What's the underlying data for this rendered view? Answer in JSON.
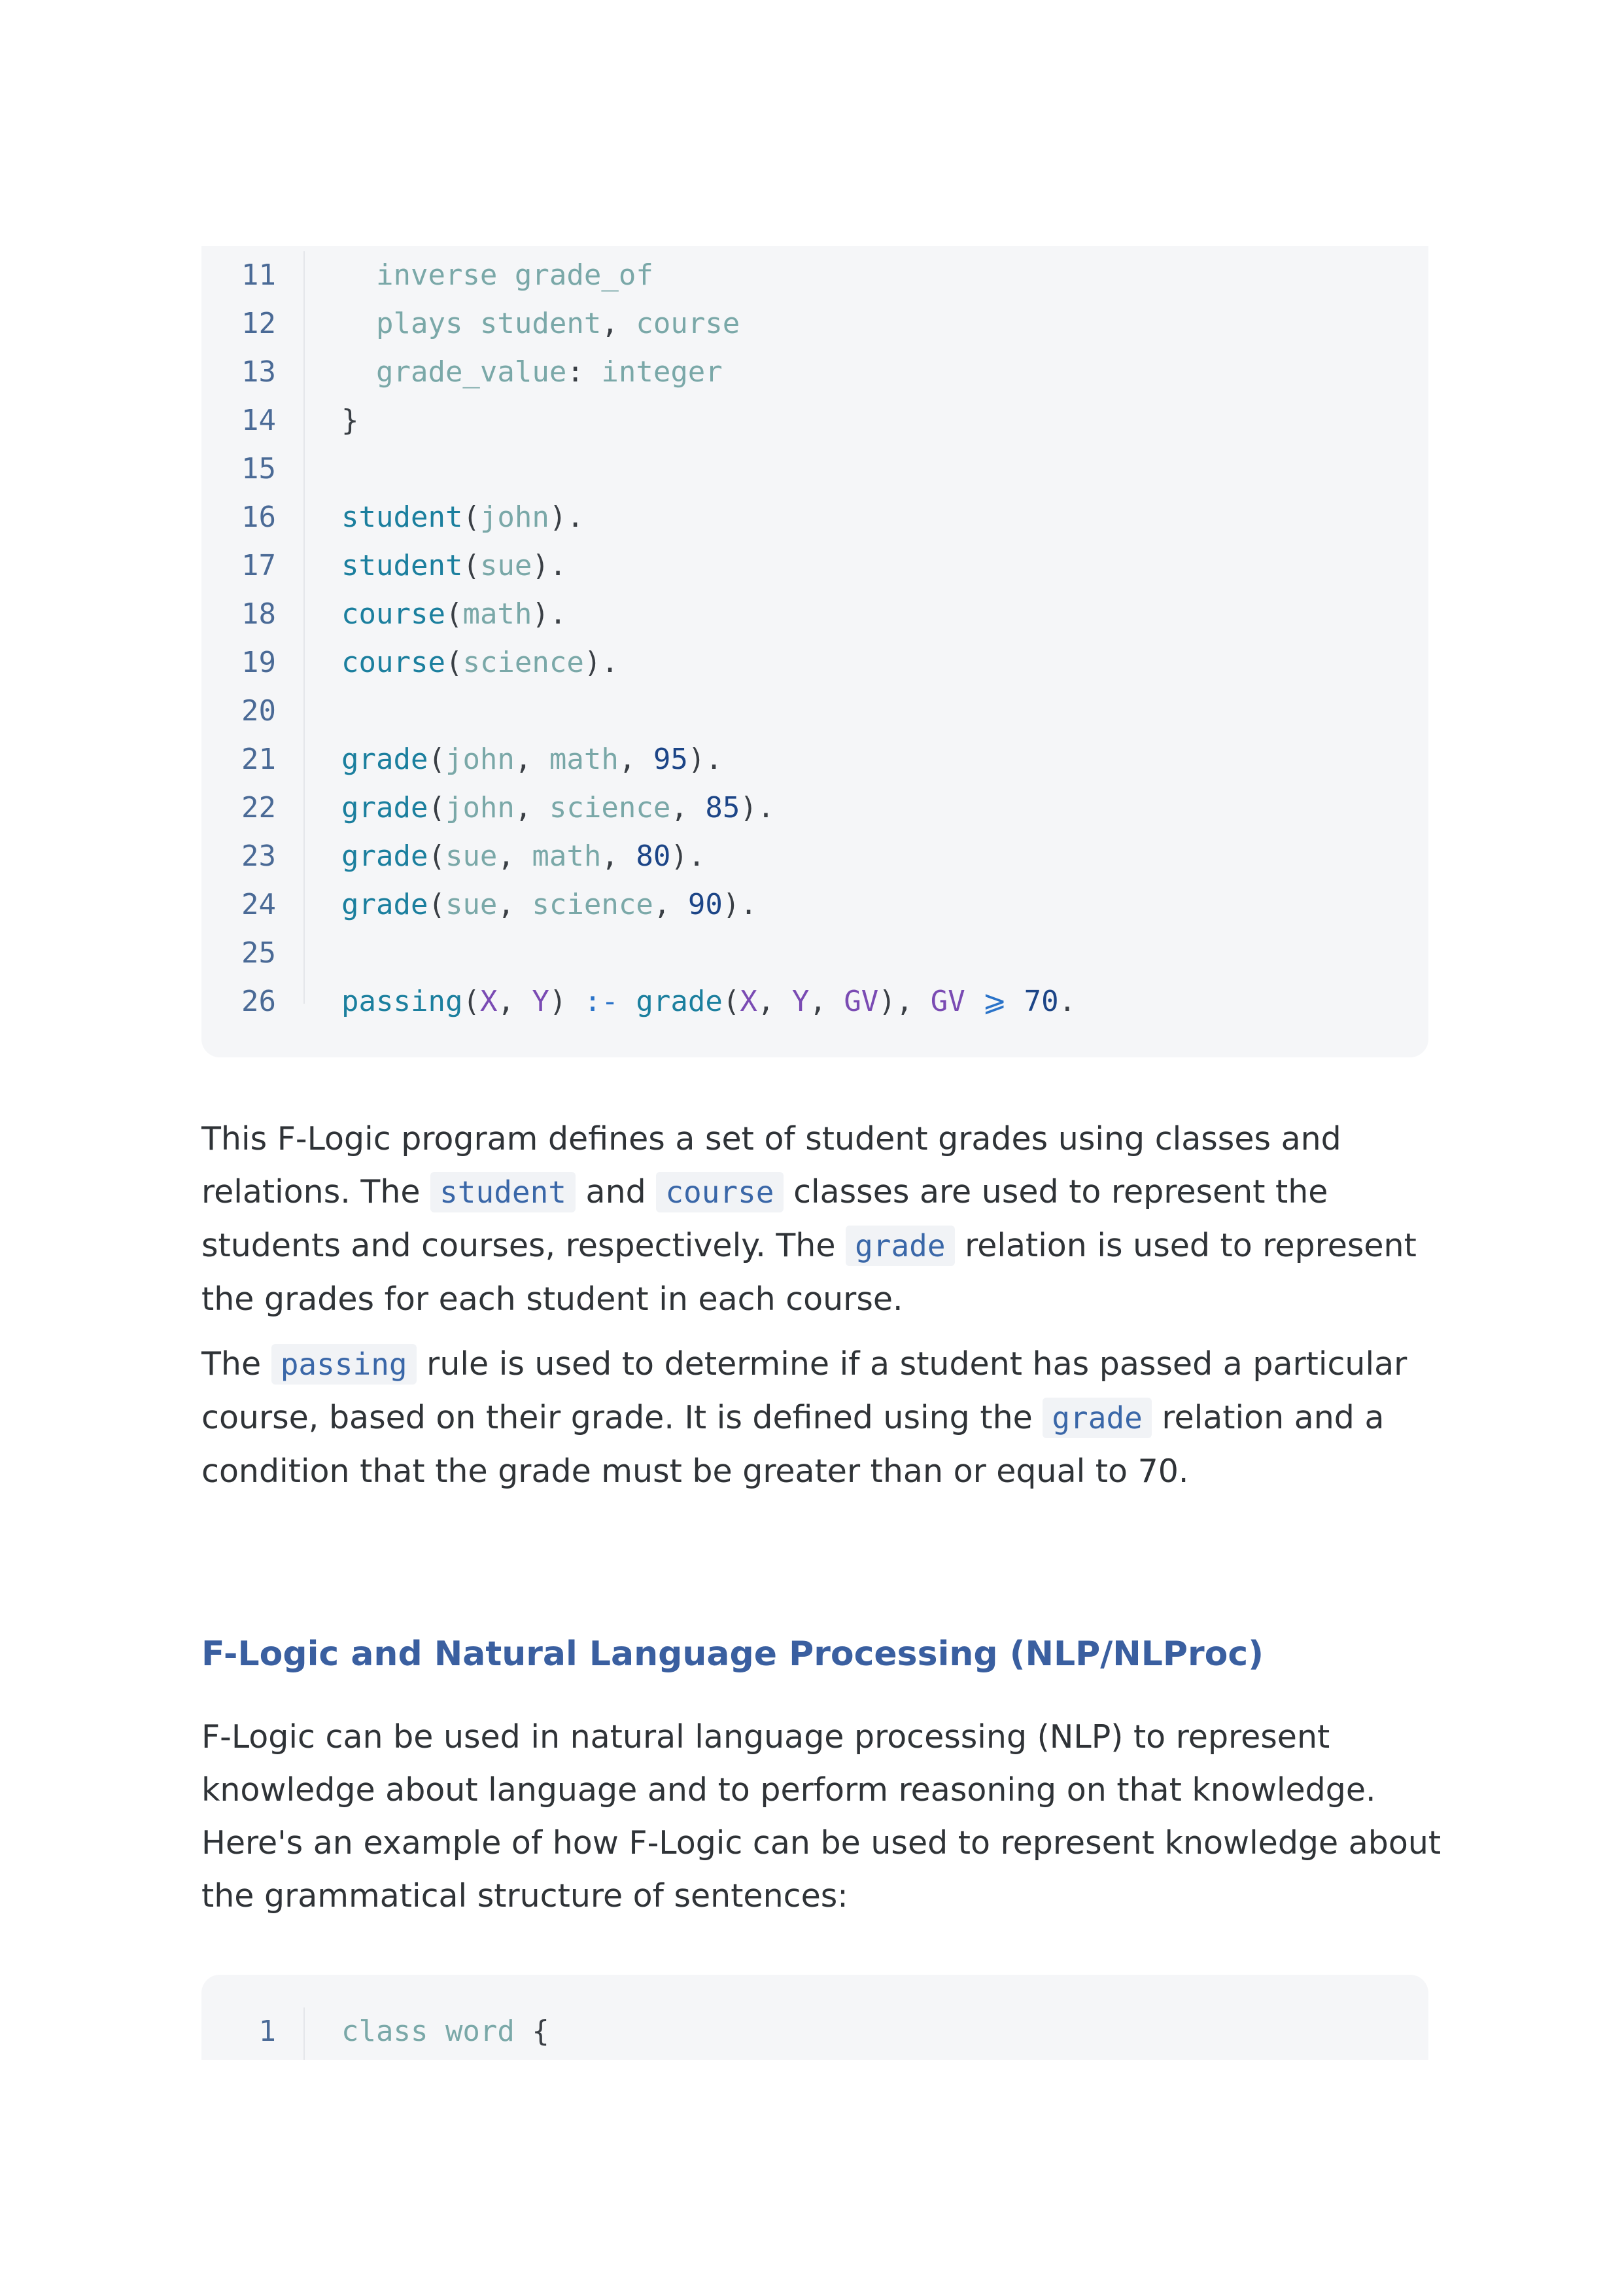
{
  "code_block_1": {
    "lines": [
      {
        "num": "11",
        "tokens": [
          {
            "t": "  inverse grade_of",
            "c": "kw"
          }
        ]
      },
      {
        "num": "12",
        "tokens": [
          {
            "t": "  plays student",
            "c": "kw"
          },
          {
            "t": ", ",
            "c": "punc"
          },
          {
            "t": "course",
            "c": "kw"
          }
        ]
      },
      {
        "num": "13",
        "tokens": [
          {
            "t": "  grade_value",
            "c": "kw"
          },
          {
            "t": ": ",
            "c": "punc"
          },
          {
            "t": "integer",
            "c": "kw"
          }
        ]
      },
      {
        "num": "14",
        "tokens": [
          {
            "t": "}",
            "c": "punc"
          }
        ]
      },
      {
        "num": "15",
        "tokens": []
      },
      {
        "num": "16",
        "tokens": [
          {
            "t": "student",
            "c": "fn"
          },
          {
            "t": "(",
            "c": "punc"
          },
          {
            "t": "john",
            "c": "arg"
          },
          {
            "t": ").",
            "c": "punc"
          }
        ]
      },
      {
        "num": "17",
        "tokens": [
          {
            "t": "student",
            "c": "fn"
          },
          {
            "t": "(",
            "c": "punc"
          },
          {
            "t": "sue",
            "c": "arg"
          },
          {
            "t": ").",
            "c": "punc"
          }
        ]
      },
      {
        "num": "18",
        "tokens": [
          {
            "t": "course",
            "c": "fn"
          },
          {
            "t": "(",
            "c": "punc"
          },
          {
            "t": "math",
            "c": "arg"
          },
          {
            "t": ").",
            "c": "punc"
          }
        ]
      },
      {
        "num": "19",
        "tokens": [
          {
            "t": "course",
            "c": "fn"
          },
          {
            "t": "(",
            "c": "punc"
          },
          {
            "t": "science",
            "c": "arg"
          },
          {
            "t": ").",
            "c": "punc"
          }
        ]
      },
      {
        "num": "20",
        "tokens": []
      },
      {
        "num": "21",
        "tokens": [
          {
            "t": "grade",
            "c": "fn"
          },
          {
            "t": "(",
            "c": "punc"
          },
          {
            "t": "john",
            "c": "arg"
          },
          {
            "t": ", ",
            "c": "punc"
          },
          {
            "t": "math",
            "c": "arg"
          },
          {
            "t": ", ",
            "c": "punc"
          },
          {
            "t": "95",
            "c": "num"
          },
          {
            "t": ").",
            "c": "punc"
          }
        ]
      },
      {
        "num": "22",
        "tokens": [
          {
            "t": "grade",
            "c": "fn"
          },
          {
            "t": "(",
            "c": "punc"
          },
          {
            "t": "john",
            "c": "arg"
          },
          {
            "t": ", ",
            "c": "punc"
          },
          {
            "t": "science",
            "c": "arg"
          },
          {
            "t": ", ",
            "c": "punc"
          },
          {
            "t": "85",
            "c": "num"
          },
          {
            "t": ").",
            "c": "punc"
          }
        ]
      },
      {
        "num": "23",
        "tokens": [
          {
            "t": "grade",
            "c": "fn"
          },
          {
            "t": "(",
            "c": "punc"
          },
          {
            "t": "sue",
            "c": "arg"
          },
          {
            "t": ", ",
            "c": "punc"
          },
          {
            "t": "math",
            "c": "arg"
          },
          {
            "t": ", ",
            "c": "punc"
          },
          {
            "t": "80",
            "c": "num"
          },
          {
            "t": ").",
            "c": "punc"
          }
        ]
      },
      {
        "num": "24",
        "tokens": [
          {
            "t": "grade",
            "c": "fn"
          },
          {
            "t": "(",
            "c": "punc"
          },
          {
            "t": "sue",
            "c": "arg"
          },
          {
            "t": ", ",
            "c": "punc"
          },
          {
            "t": "science",
            "c": "arg"
          },
          {
            "t": ", ",
            "c": "punc"
          },
          {
            "t": "90",
            "c": "num"
          },
          {
            "t": ").",
            "c": "punc"
          }
        ]
      },
      {
        "num": "25",
        "tokens": []
      },
      {
        "num": "26",
        "tokens": [
          {
            "t": "passing",
            "c": "fn"
          },
          {
            "t": "(",
            "c": "punc"
          },
          {
            "t": "X",
            "c": "var"
          },
          {
            "t": ", ",
            "c": "punc"
          },
          {
            "t": "Y",
            "c": "var"
          },
          {
            "t": ") ",
            "c": "punc"
          },
          {
            "t": ":-",
            "c": "op"
          },
          {
            "t": " ",
            "c": "punc"
          },
          {
            "t": "grade",
            "c": "fn"
          },
          {
            "t": "(",
            "c": "punc"
          },
          {
            "t": "X",
            "c": "var"
          },
          {
            "t": ", ",
            "c": "punc"
          },
          {
            "t": "Y",
            "c": "var"
          },
          {
            "t": ", ",
            "c": "punc"
          },
          {
            "t": "GV",
            "c": "var"
          },
          {
            "t": "), ",
            "c": "punc"
          },
          {
            "t": "GV",
            "c": "var"
          },
          {
            "t": " ",
            "c": "punc"
          },
          {
            "t": "⩾",
            "c": "op"
          },
          {
            "t": " ",
            "c": "punc"
          },
          {
            "t": "70",
            "c": "num"
          },
          {
            "t": ".",
            "c": "punc"
          }
        ]
      }
    ]
  },
  "para1": {
    "s1": "This F-Logic program defines a set of student grades using classes and relations. The ",
    "c1": "student",
    "s2": " and ",
    "c2": "course",
    "s3": " classes are used to represent the students and courses, respectively. The ",
    "c3": "grade",
    "s4": " relation is used to represent the grades for each student in each course."
  },
  "para2": {
    "s1": "The ",
    "c1": "passing",
    "s2": " rule is used to determine if a student has passed a particular course, based on their grade. It is defined using the ",
    "c2": "grade",
    "s3": " relation and a condition that the grade must be greater than or equal to 70."
  },
  "heading": "F-Logic and Natural Language Processing (NLP/NLProc)",
  "para3": "F-Logic can be used in natural language processing (NLP) to represent knowledge about language and to perform reasoning on that knowledge. Here's an example of how F-Logic can be used to represent knowledge about the grammatical structure of sentences:",
  "code_block_2": {
    "lines": [
      {
        "num": "1",
        "tokens": [
          {
            "t": "class word",
            "c": "kw"
          },
          {
            "t": " {",
            "c": "punc"
          }
        ]
      }
    ]
  }
}
